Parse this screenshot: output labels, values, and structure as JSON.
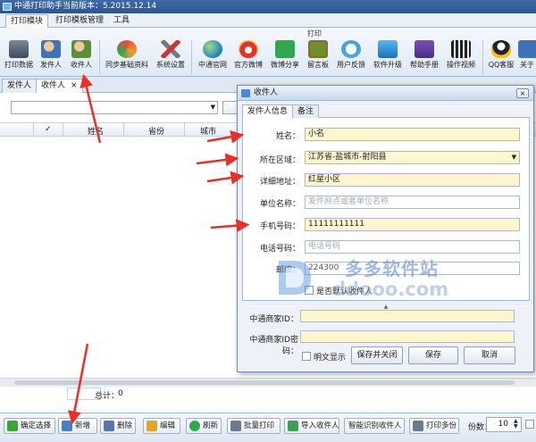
{
  "window": {
    "title": "中通打印助手当前版本：5.2015.12.14"
  },
  "menu_tabs": [
    {
      "label": "打印模块",
      "active": true
    },
    {
      "label": "打印模板管理",
      "active": false
    },
    {
      "label": "工具",
      "active": false
    }
  ],
  "ribbon": {
    "group_label": "打印",
    "buttons": [
      {
        "label": "打印数据",
        "icon": "print-icon"
      },
      {
        "label": "发件人",
        "icon": "sender-icon"
      },
      {
        "label": "收件人",
        "icon": "receiver-icon"
      },
      {
        "label": "同步基础资料",
        "icon": "sync-icon"
      },
      {
        "label": "系统设置",
        "icon": "settings-icon"
      },
      {
        "label": "中通官网",
        "icon": "globe-icon"
      },
      {
        "label": "官方微博",
        "icon": "weibo-icon"
      },
      {
        "label": "微博分享",
        "icon": "share-icon"
      },
      {
        "label": "留言板",
        "icon": "board-icon"
      },
      {
        "label": "用户反馈",
        "icon": "feedback-icon"
      },
      {
        "label": "软件升级",
        "icon": "upgrade-icon"
      },
      {
        "label": "帮助手册",
        "icon": "help-icon"
      },
      {
        "label": "操作视频",
        "icon": "video-icon"
      },
      {
        "label": "QQ客服",
        "icon": "qq-icon"
      },
      {
        "label": "关于",
        "icon": "about-icon"
      }
    ]
  },
  "doc_tabs": [
    {
      "label": "发件人",
      "active": false
    },
    {
      "label": "收件人",
      "active": true,
      "close": "×"
    }
  ],
  "table": {
    "headers": [
      "✓",
      "姓名",
      "省份",
      "城市"
    ]
  },
  "footer": {
    "total_label": "总计：",
    "total_value": "0"
  },
  "bottom_toolbar": {
    "buttons": [
      {
        "label": "确定选择",
        "icon": "confirm-icon"
      },
      {
        "label": "新增",
        "icon": "add-icon"
      },
      {
        "label": "删除",
        "icon": "delete-icon"
      },
      {
        "label": "编辑",
        "icon": "edit-icon"
      },
      {
        "label": "刷新",
        "icon": "refresh-icon"
      },
      {
        "label": "批量打印",
        "icon": "print-icon"
      },
      {
        "label": "导入收件人",
        "icon": "import-icon"
      },
      {
        "label": "智能识别收件人",
        "icon": "smart-icon"
      },
      {
        "label": "打印多份",
        "icon": "print-icon"
      }
    ],
    "copies_label": "份数：",
    "copies_value": "10"
  },
  "dialog": {
    "title": "收件人",
    "close": "×",
    "tabs": [
      {
        "label": "发件人信息",
        "active": true
      },
      {
        "label": "备注",
        "active": false
      }
    ],
    "fields": {
      "name": {
        "label": "姓名：",
        "value": "小名"
      },
      "region": {
        "label": "所在区域：",
        "value": "江苏省-盐城市-射阳县"
      },
      "address": {
        "label": "详细地址：",
        "value": "红星小区"
      },
      "company": {
        "label": "单位名称：",
        "placeholder": "发件网点或者单位名称"
      },
      "mobile": {
        "label": "手机号码：",
        "value": "11111111111"
      },
      "phone": {
        "label": "电话号码：",
        "placeholder": "电话号码"
      },
      "zip": {
        "label": "邮编：",
        "value": "224300"
      }
    },
    "default_checkbox": "是否默认收件人",
    "merchant_id_label": "中通商家ID：",
    "merchant_pw_label": "中通商家ID密码：",
    "plain_text_label": "明文显示",
    "buttons": {
      "save_close": "保存并关闭",
      "save": "保存",
      "cancel": "取消"
    }
  },
  "watermark": {
    "name": "多多软件站",
    "url": "ddooo.com"
  },
  "colors": {
    "accent": "#2c5590",
    "highlight_field": "#fdf6cf",
    "arrow": "#e8302a"
  }
}
